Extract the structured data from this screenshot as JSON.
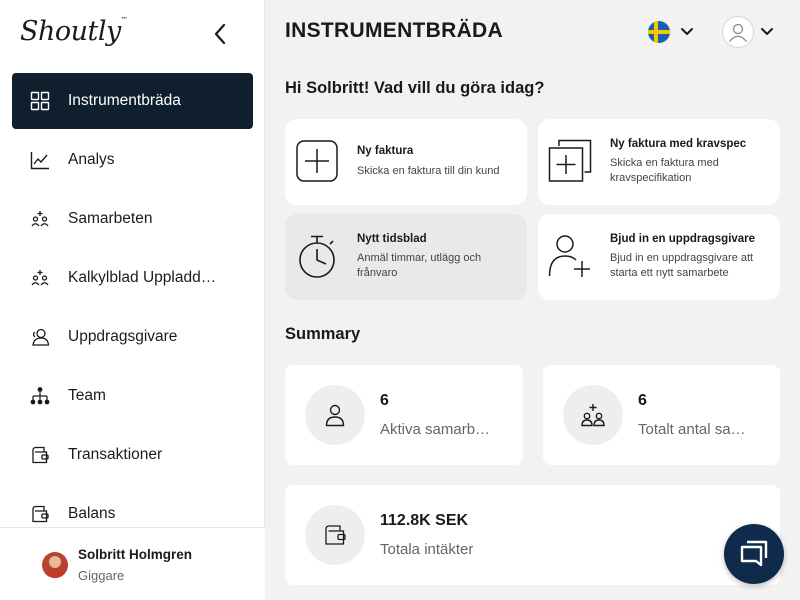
{
  "app": {
    "logo": "Shoutly",
    "logo_mark": "™"
  },
  "sidebar": {
    "items": [
      {
        "label": "Instrumentbräda",
        "icon": "grid-icon",
        "active": true
      },
      {
        "label": "Analys",
        "icon": "chart-icon"
      },
      {
        "label": "Samarbeten",
        "icon": "people-plus-icon"
      },
      {
        "label": "Kalkylblad Uppladd…",
        "icon": "people-plus-icon"
      },
      {
        "label": "Uppdragsgivare",
        "icon": "client-icon"
      },
      {
        "label": "Team",
        "icon": "org-chart-icon"
      },
      {
        "label": "Transaktioner",
        "icon": "wallet-icon"
      },
      {
        "label": "Balans",
        "icon": "wallet-icon"
      }
    ],
    "user": {
      "name": "Solbritt Holmgren",
      "role": "Giggare"
    }
  },
  "header": {
    "title": "INSTRUMENTBRÄDA"
  },
  "greeting": "Hi Solbritt! Vad vill du göra idag?",
  "actions": [
    {
      "title": "Ny faktura",
      "desc": "Skicka en faktura till din kund",
      "icon": "plus-box-icon"
    },
    {
      "title": "Ny faktura med kravspec",
      "desc": "Skicka en faktura med kravspecifikation",
      "icon": "stacked-plus-icon"
    },
    {
      "title": "Nytt tidsblad",
      "desc": "Anmäl timmar, utlägg och frånvaro",
      "icon": "stopwatch-icon"
    },
    {
      "title": "Bjud in en uppdragsgivare",
      "desc": "Bjud in en uppdragsgivare att starta ett nytt samarbete",
      "icon": "add-person-icon"
    }
  ],
  "summary": {
    "title": "Summary",
    "stats": [
      {
        "value": "6",
        "label": "Aktiva samarb…",
        "icon": "person-icon"
      },
      {
        "value": "6",
        "label": "Totalt antal sa…",
        "icon": "people-plus-icon"
      },
      {
        "value": "112.8K SEK",
        "label": "Totala intäkter",
        "icon": "wallet-icon"
      }
    ]
  },
  "colors": {
    "sidebar_active": "#0f1f2e",
    "chat_button": "#0f2a4a",
    "background": "#f2f2f2"
  }
}
